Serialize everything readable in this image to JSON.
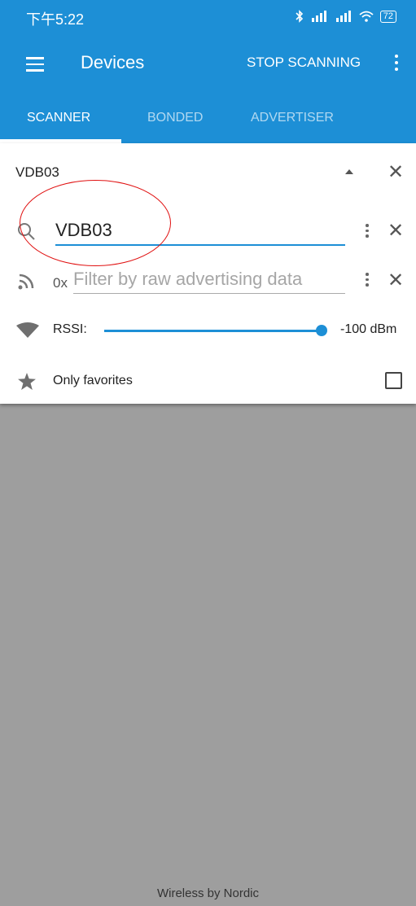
{
  "status": {
    "time": "下午5:22",
    "battery": "72"
  },
  "appbar": {
    "title": "Devices",
    "action": "STOP SCANNING"
  },
  "tabs": [
    {
      "label": "SCANNER",
      "active": true
    },
    {
      "label": "BONDED",
      "active": false
    },
    {
      "label": "ADVERTISER",
      "active": false
    }
  ],
  "filter": {
    "header": "VDB03",
    "name_value": "VDB03",
    "raw_prefix": "0x",
    "raw_placeholder": "Filter by raw advertising data",
    "rssi_label": "RSSI:",
    "rssi_value": "-100 dBm",
    "favorites_label": "Only favorites"
  },
  "footer": "Wireless by Nordic",
  "colors": {
    "primary": "#1d8fd6",
    "annotation": "#e01010",
    "background": "#9e9e9e"
  }
}
